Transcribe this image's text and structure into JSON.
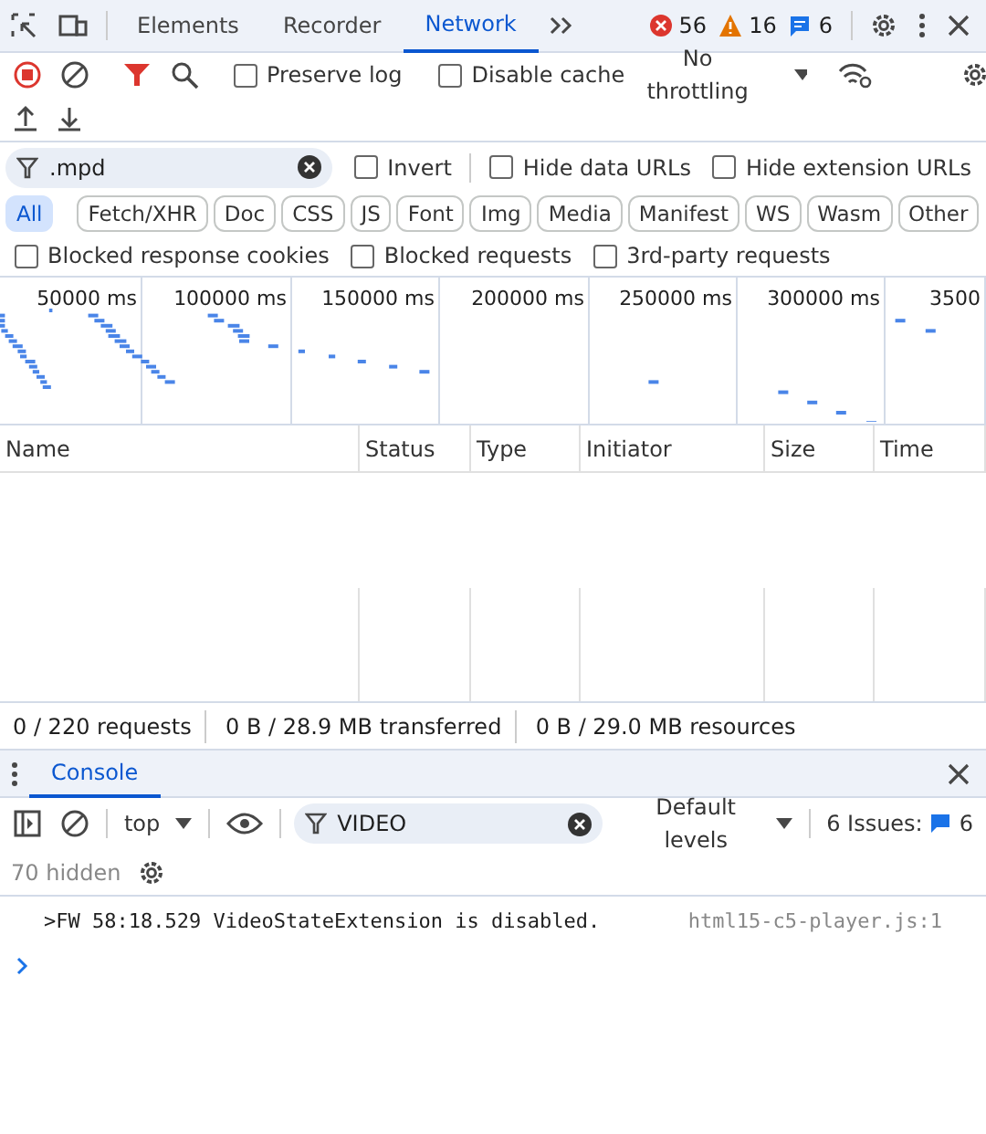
{
  "top_tabs": [
    {
      "label": "Elements",
      "selected": false
    },
    {
      "label": "Recorder",
      "selected": false
    },
    {
      "label": "Network",
      "selected": true
    }
  ],
  "counters": [
    {
      "kind": "error",
      "count": "56"
    },
    {
      "kind": "warning",
      "count": "16"
    },
    {
      "kind": "info",
      "count": "6"
    }
  ],
  "toolbar": {
    "options": [
      {
        "label": "Preserve log",
        "checked": false
      },
      {
        "label": "Disable cache",
        "checked": false
      }
    ],
    "throttling": "No throttling"
  },
  "filter": {
    "value": ".mpd",
    "options": [
      {
        "label": "Invert",
        "checked": false
      },
      {
        "label": "Hide data URLs",
        "checked": false
      },
      {
        "label": "Hide extension URLs",
        "checked": false
      }
    ]
  },
  "type_filters": [
    {
      "label": "All",
      "selected": true
    },
    {
      "label": "Fetch/XHR",
      "selected": false
    },
    {
      "label": "Doc",
      "selected": false
    },
    {
      "label": "CSS",
      "selected": false
    },
    {
      "label": "JS",
      "selected": false
    },
    {
      "label": "Font",
      "selected": false
    },
    {
      "label": "Img",
      "selected": false
    },
    {
      "label": "Media",
      "selected": false
    },
    {
      "label": "Manifest",
      "selected": false
    },
    {
      "label": "WS",
      "selected": false
    },
    {
      "label": "Wasm",
      "selected": false
    },
    {
      "label": "Other",
      "selected": false
    }
  ],
  "blocked_options": [
    {
      "label": "Blocked response cookies",
      "checked": false
    },
    {
      "label": "Blocked requests",
      "checked": false
    },
    {
      "label": "3rd-party requests",
      "checked": false
    }
  ],
  "overview": {
    "ticks": [
      "50000 ms",
      "100000 ms",
      "150000 ms",
      "200000 ms",
      "250000 ms",
      "300000 ms",
      "3500"
    ]
  },
  "table": {
    "columns": [
      "Name",
      "Status",
      "Type",
      "Initiator",
      "Size",
      "Time"
    ]
  },
  "status_bar": [
    "0 / 220 requests",
    "0 B / 28.9 MB transferred",
    "0 B / 29.0 MB resources"
  ],
  "drawer_tabs": [
    {
      "label": "Console",
      "selected": true
    }
  ],
  "console": {
    "context": "top",
    "filter": "VIDEO",
    "levels": "Default levels",
    "issues_label": "6 Issues:",
    "issues_count": "6",
    "hidden": "70 hidden",
    "messages": [
      {
        "text": ">FW 58:18.529 VideoStateExtension is disabled.",
        "source": "html15-c5-player.js:1"
      }
    ]
  }
}
